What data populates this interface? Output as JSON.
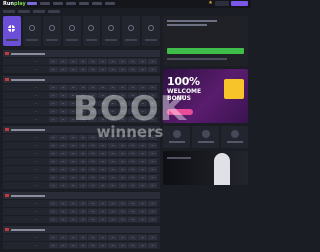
{
  "header": {
    "logo_main": "Run",
    "logo_accent": "play",
    "nav_items": [
      "",
      "",
      "",
      "",
      "",
      "",
      ""
    ],
    "login_label": "",
    "register_label": ""
  },
  "sub_tabs": [
    "",
    "",
    "",
    ""
  ],
  "sports": [
    "",
    "",
    "",
    "",
    "",
    "",
    "",
    ""
  ],
  "sections": [
    {
      "title": "",
      "rows": [
        {
          "team": "",
          "score": "—",
          "odds": [
            "—",
            "—",
            "—",
            "—",
            "—",
            "—",
            "—",
            "—",
            "—",
            "—",
            "—"
          ]
        },
        {
          "team": "",
          "score": "—",
          "odds": [
            "—",
            "—",
            "—",
            "—",
            "—",
            "—",
            "—",
            "—",
            "—",
            "—",
            "—"
          ]
        }
      ]
    },
    {
      "title": "",
      "rows": [
        {
          "team": "",
          "score": "—",
          "odds": [
            "—",
            "—",
            "—",
            "—",
            "—",
            "—",
            "—",
            "—",
            "—",
            "—",
            "—"
          ]
        },
        {
          "team": "",
          "score": "—",
          "odds": [
            "—",
            "—",
            "—",
            "—",
            "—",
            "—",
            "—",
            "—",
            "—",
            "—",
            "—"
          ]
        },
        {
          "team": "",
          "score": "—",
          "odds": [
            "—",
            "—",
            "—",
            "—",
            "—",
            "—",
            "—",
            "—",
            "—",
            "—",
            "—"
          ]
        },
        {
          "team": "",
          "score": "—",
          "odds": [
            "—",
            "—",
            "—",
            "—",
            "—",
            "—",
            "—",
            "—",
            "—",
            "—",
            "—"
          ]
        },
        {
          "team": "",
          "score": "—",
          "odds": [
            "—",
            "—",
            "—",
            "—",
            "—",
            "—",
            "—",
            "—",
            "—",
            "—",
            "—"
          ]
        }
      ]
    },
    {
      "title": "",
      "rows": [
        {
          "team": "",
          "score": "—",
          "odds": [
            "—",
            "—",
            "—",
            "—",
            "—",
            "—",
            "—",
            "—",
            "—",
            "—",
            "—"
          ]
        },
        {
          "team": "",
          "score": "—",
          "odds": [
            "—",
            "—",
            "—",
            "—",
            "—",
            "—",
            "—",
            "—",
            "—",
            "—",
            "—"
          ]
        },
        {
          "team": "",
          "score": "—",
          "odds": [
            "—",
            "—",
            "—",
            "—",
            "—",
            "—",
            "—",
            "—",
            "—",
            "—",
            "—"
          ]
        },
        {
          "team": "",
          "score": "—",
          "odds": [
            "—",
            "—",
            "—",
            "—",
            "—",
            "—",
            "—",
            "—",
            "—",
            "—",
            "—"
          ]
        },
        {
          "team": "",
          "score": "—",
          "odds": [
            "—",
            "—",
            "—",
            "—",
            "—",
            "—",
            "—",
            "—",
            "—",
            "—",
            "—"
          ]
        },
        {
          "team": "",
          "score": "—",
          "odds": [
            "—",
            "—",
            "—",
            "—",
            "—",
            "—",
            "—",
            "—",
            "—",
            "—",
            "—"
          ]
        },
        {
          "team": "",
          "score": "—",
          "odds": [
            "—",
            "—",
            "—",
            "—",
            "—",
            "—",
            "—",
            "—",
            "—",
            "—",
            "—"
          ]
        }
      ]
    },
    {
      "title": "",
      "rows": [
        {
          "team": "",
          "score": "—",
          "odds": [
            "—",
            "—",
            "—",
            "—",
            "—",
            "—",
            "—",
            "—",
            "—",
            "—",
            "—"
          ]
        },
        {
          "team": "",
          "score": "—",
          "odds": [
            "—",
            "—",
            "—",
            "—",
            "—",
            "—",
            "—",
            "—",
            "—",
            "—",
            "—"
          ]
        },
        {
          "team": "",
          "score": "—",
          "odds": [
            "—",
            "—",
            "—",
            "—",
            "—",
            "—",
            "—",
            "—",
            "—",
            "—",
            "—"
          ]
        }
      ]
    },
    {
      "title": "",
      "rows": [
        {
          "team": "",
          "score": "—",
          "odds": [
            "—",
            "—",
            "—",
            "—",
            "—",
            "—",
            "—",
            "—",
            "—",
            "—",
            "—"
          ]
        },
        {
          "team": "",
          "score": "—",
          "odds": [
            "—",
            "—",
            "—",
            "—",
            "—",
            "—",
            "—",
            "—",
            "—",
            "—",
            "—"
          ]
        }
      ]
    }
  ],
  "promo": {
    "button_label": ""
  },
  "banner": {
    "amount": "100%",
    "line1": "WELCOME",
    "line2": "BONUS"
  },
  "watermark": {
    "line1": "BOOK",
    "line2": "winners"
  },
  "colors": {
    "accent": "#6c4fd9",
    "register": "#7b59e8",
    "cta_green": "#3fbf4a",
    "banner_bg": "#5a1c6e"
  },
  "icons": [
    "grid-icon",
    "star-icon",
    "sport-icon",
    "gift-icon"
  ]
}
